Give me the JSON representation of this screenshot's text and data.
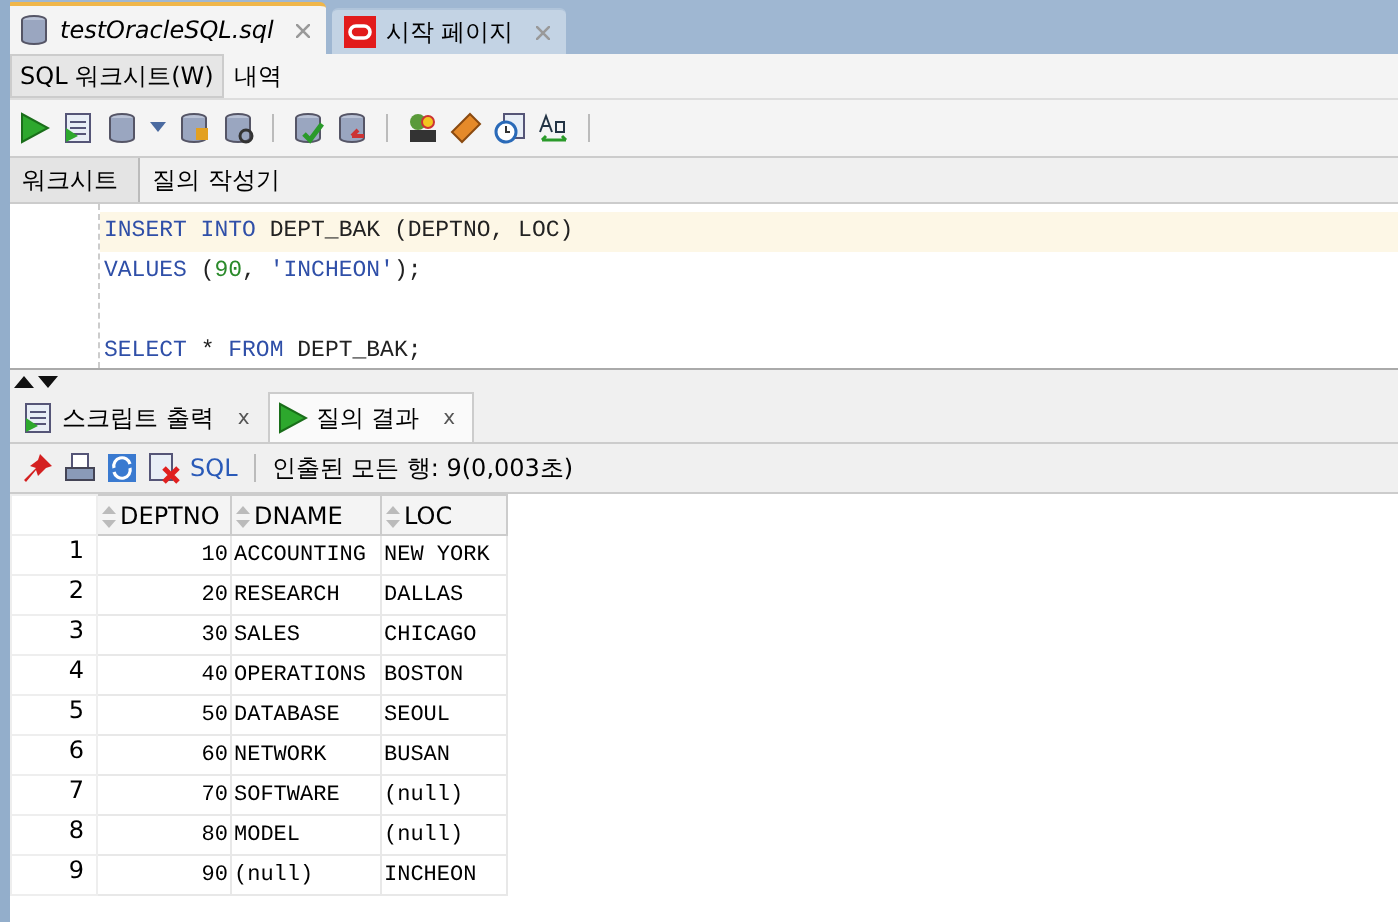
{
  "editor_tabs": [
    {
      "label": "testOracleSQL.sql",
      "selected": true
    },
    {
      "label": "시작 페이지",
      "selected": false
    }
  ],
  "sub_tabs": [
    {
      "label": "SQL 워크시트(W)",
      "selected": true
    },
    {
      "label": "내역",
      "selected": false
    }
  ],
  "worksheet_tabs": [
    {
      "label": "워크시트",
      "selected": true
    },
    {
      "label": "질의 작성기",
      "selected": false
    }
  ],
  "code_lines": [
    {
      "tokens": [
        {
          "text": "INSERT INTO ",
          "kind": "keyword"
        },
        {
          "text": "DEPT_BAK (DEPTNO, LOC)",
          "kind": "ident"
        }
      ]
    },
    {
      "tokens": [
        {
          "text": "VALUES ",
          "kind": "keyword"
        },
        {
          "text": "(",
          "kind": "ident"
        },
        {
          "text": "90",
          "kind": "number"
        },
        {
          "text": ", ",
          "kind": "ident"
        },
        {
          "text": "'INCHEON'",
          "kind": "string"
        },
        {
          "text": ");",
          "kind": "ident"
        }
      ]
    },
    {
      "blank_before": true,
      "tokens": [
        {
          "text": "SELECT ",
          "kind": "keyword"
        },
        {
          "text": "* ",
          "kind": "ident"
        },
        {
          "text": "FROM ",
          "kind": "keyword"
        },
        {
          "text": "DEPT_BAK;",
          "kind": "ident"
        }
      ]
    }
  ],
  "result_tabs": [
    {
      "label": "스크립트 출력",
      "selected": false,
      "close": "x"
    },
    {
      "label": "질의 결과",
      "selected": true,
      "close": "x"
    }
  ],
  "result_toolbar": {
    "sql_link": "SQL",
    "status": "인출된 모든 행: 9(0,003초)"
  },
  "table": {
    "columns": [
      "",
      "DEPTNO",
      "DNAME",
      "LOC"
    ],
    "rows": [
      [
        "1",
        "10",
        "ACCOUNTING",
        "NEW YORK"
      ],
      [
        "2",
        "20",
        "RESEARCH",
        "DALLAS"
      ],
      [
        "3",
        "30",
        "SALES",
        "CHICAGO"
      ],
      [
        "4",
        "40",
        "OPERATIONS",
        "BOSTON"
      ],
      [
        "5",
        "50",
        "DATABASE",
        "SEOUL"
      ],
      [
        "6",
        "60",
        "NETWORK",
        "BUSAN"
      ],
      [
        "7",
        "70",
        "SOFTWARE",
        "(null)"
      ],
      [
        "8",
        "80",
        "MODEL",
        "(null)"
      ],
      [
        "9",
        "90",
        "(null)",
        "INCHEON"
      ]
    ]
  }
}
